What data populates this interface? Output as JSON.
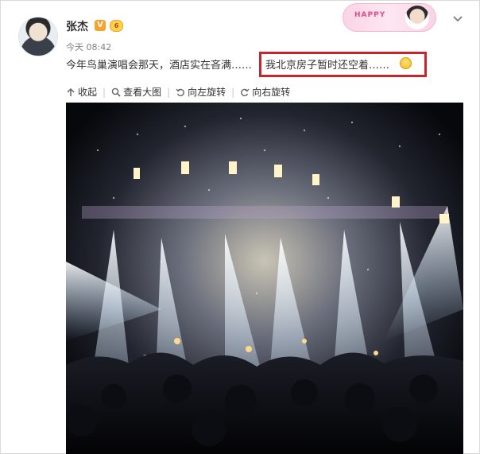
{
  "post": {
    "user_name": "张杰",
    "verified_badge": "V",
    "member_badge": "6",
    "timestamp": "今天 08:42",
    "text": "今年鸟巢演唱会那天，酒店实在吝满……",
    "highlighted_text": "我北京房子暂时还空着……",
    "banner_text": "HAPPY"
  },
  "actions": [
    {
      "label": "收起",
      "icon": "collapse-icon"
    },
    {
      "label": "查看大图",
      "icon": "search-icon"
    },
    {
      "label": "向左旋转",
      "icon": "rotate-left-icon"
    },
    {
      "label": "向右旋转",
      "icon": "rotate-right-icon"
    }
  ],
  "colors": {
    "highlight_border": "#c8242b",
    "verified": "#f7a32b",
    "text": "#333333",
    "meta": "#808080"
  }
}
